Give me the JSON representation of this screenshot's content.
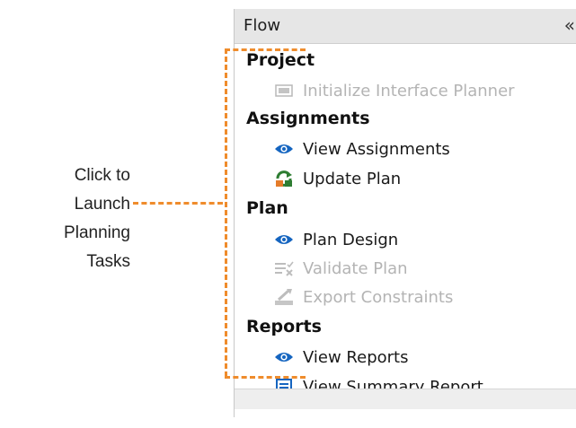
{
  "callout": {
    "line1": "Click to Launch",
    "line2": "Planning Tasks"
  },
  "panel": {
    "title": "Flow",
    "collapse_glyph": "«"
  },
  "sections": [
    {
      "title": "Project",
      "tasks": [
        {
          "label": "Initialize Interface Planner",
          "icon": "initialize-planner-icon",
          "enabled": false
        }
      ]
    },
    {
      "title": "Assignments",
      "tasks": [
        {
          "label": "View Assignments",
          "icon": "eye-icon",
          "enabled": true
        },
        {
          "label": "Update Plan",
          "icon": "update-plan-icon",
          "enabled": true
        }
      ]
    },
    {
      "title": "Plan",
      "tasks": [
        {
          "label": "Plan Design",
          "icon": "eye-icon",
          "enabled": true
        },
        {
          "label": "Validate Plan",
          "icon": "validate-plan-icon",
          "enabled": false
        },
        {
          "label": "Export Constraints",
          "icon": "export-constraints-icon",
          "enabled": false
        }
      ]
    },
    {
      "title": "Reports",
      "tasks": [
        {
          "label": "View Reports",
          "icon": "eye-icon",
          "enabled": true
        },
        {
          "label": "View Summary Report",
          "icon": "summary-report-icon",
          "enabled": true
        }
      ]
    }
  ],
  "colors": {
    "accent_blue": "#1565c0",
    "callout_orange": "#ef8c2c",
    "disabled_text": "#b4b4b4"
  }
}
